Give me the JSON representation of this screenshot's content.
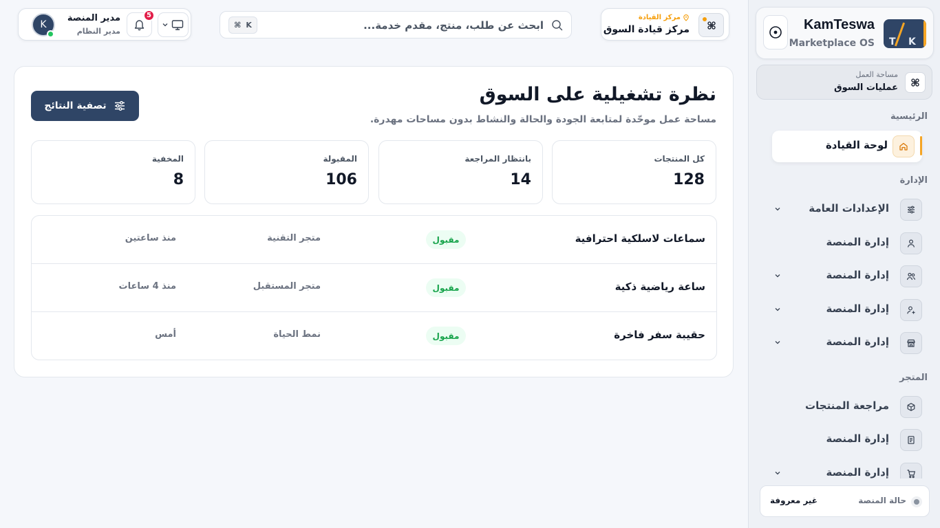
{
  "brand": {
    "name": "KamTeswa",
    "subtitle": "Marketplace OS",
    "logo_letters": [
      "T",
      "K"
    ]
  },
  "workspace": {
    "label": "مساحة العمل",
    "value": "عمليات السوق"
  },
  "sidebar": {
    "sections": {
      "main": "الرئيسية",
      "admin": "الإدارة",
      "store": "المتجر"
    },
    "active_item": {
      "label": "لوحة القيادة",
      "icon": "home-icon"
    },
    "admin_items": [
      {
        "label": "الإعدادات العامة",
        "icon": "sliders-icon",
        "has_chevron": true
      },
      {
        "label": "إدارة المنصة",
        "icon": "user-icon",
        "has_chevron": false
      },
      {
        "label": "إدارة المنصة",
        "icon": "users-icon",
        "has_chevron": true
      },
      {
        "label": "إدارة المنصة",
        "icon": "user-plus-icon",
        "has_chevron": true
      },
      {
        "label": "إدارة المنصة",
        "icon": "store-icon",
        "has_chevron": true
      }
    ],
    "store_items": [
      {
        "label": "مراجعة المنتجات",
        "icon": "box-icon",
        "has_chevron": false
      },
      {
        "label": "إدارة المنصة",
        "icon": "document-icon",
        "has_chevron": false
      },
      {
        "label": "إدارة المنصة",
        "icon": "cart-icon",
        "has_chevron": true
      }
    ],
    "status": {
      "label": "حالة المنصة",
      "value": "غير معروفة"
    }
  },
  "topbar": {
    "hub": {
      "caption": "مركز القيادة",
      "title": "مركز قيادة السوق"
    },
    "search": {
      "placeholder": "ابحث عن طلب، منتج، مقدم خدمة...",
      "shortcut_symbol": "⌘",
      "shortcut_key": "K"
    },
    "notifications_count": "5",
    "user": {
      "name": "مدير المنصة",
      "role": "مدير النظام",
      "initial": "K"
    }
  },
  "main": {
    "title": "نظرة تشغيلية على السوق",
    "subtitle": "مساحة عمل موحّدة لمتابعة الجودة والحالة والنشاط بدون مساحات مهدرة.",
    "filter_label": "تصفية النتائج",
    "stats": [
      {
        "label": "كل المنتجات",
        "value": "128"
      },
      {
        "label": "بانتظار المراجعة",
        "value": "14"
      },
      {
        "label": "المقبولة",
        "value": "106"
      },
      {
        "label": "المخفية",
        "value": "8"
      }
    ],
    "rows": [
      {
        "name": "سماعات لاسلكية احترافية",
        "status": "مقبول",
        "store": "متجر التقنية",
        "time": "منذ ساعتين"
      },
      {
        "name": "ساعة رياضية ذكية",
        "status": "مقبول",
        "store": "متجر المستقبل",
        "time": "منذ 4 ساعات"
      },
      {
        "name": "حقيبة سفر فاخرة",
        "status": "مقبول",
        "store": "نمط الحياة",
        "time": "أمس"
      }
    ]
  },
  "colors": {
    "primary": "#2f4566",
    "accent": "#f5a524",
    "success": "#16a34a",
    "danger": "#e11d48"
  }
}
